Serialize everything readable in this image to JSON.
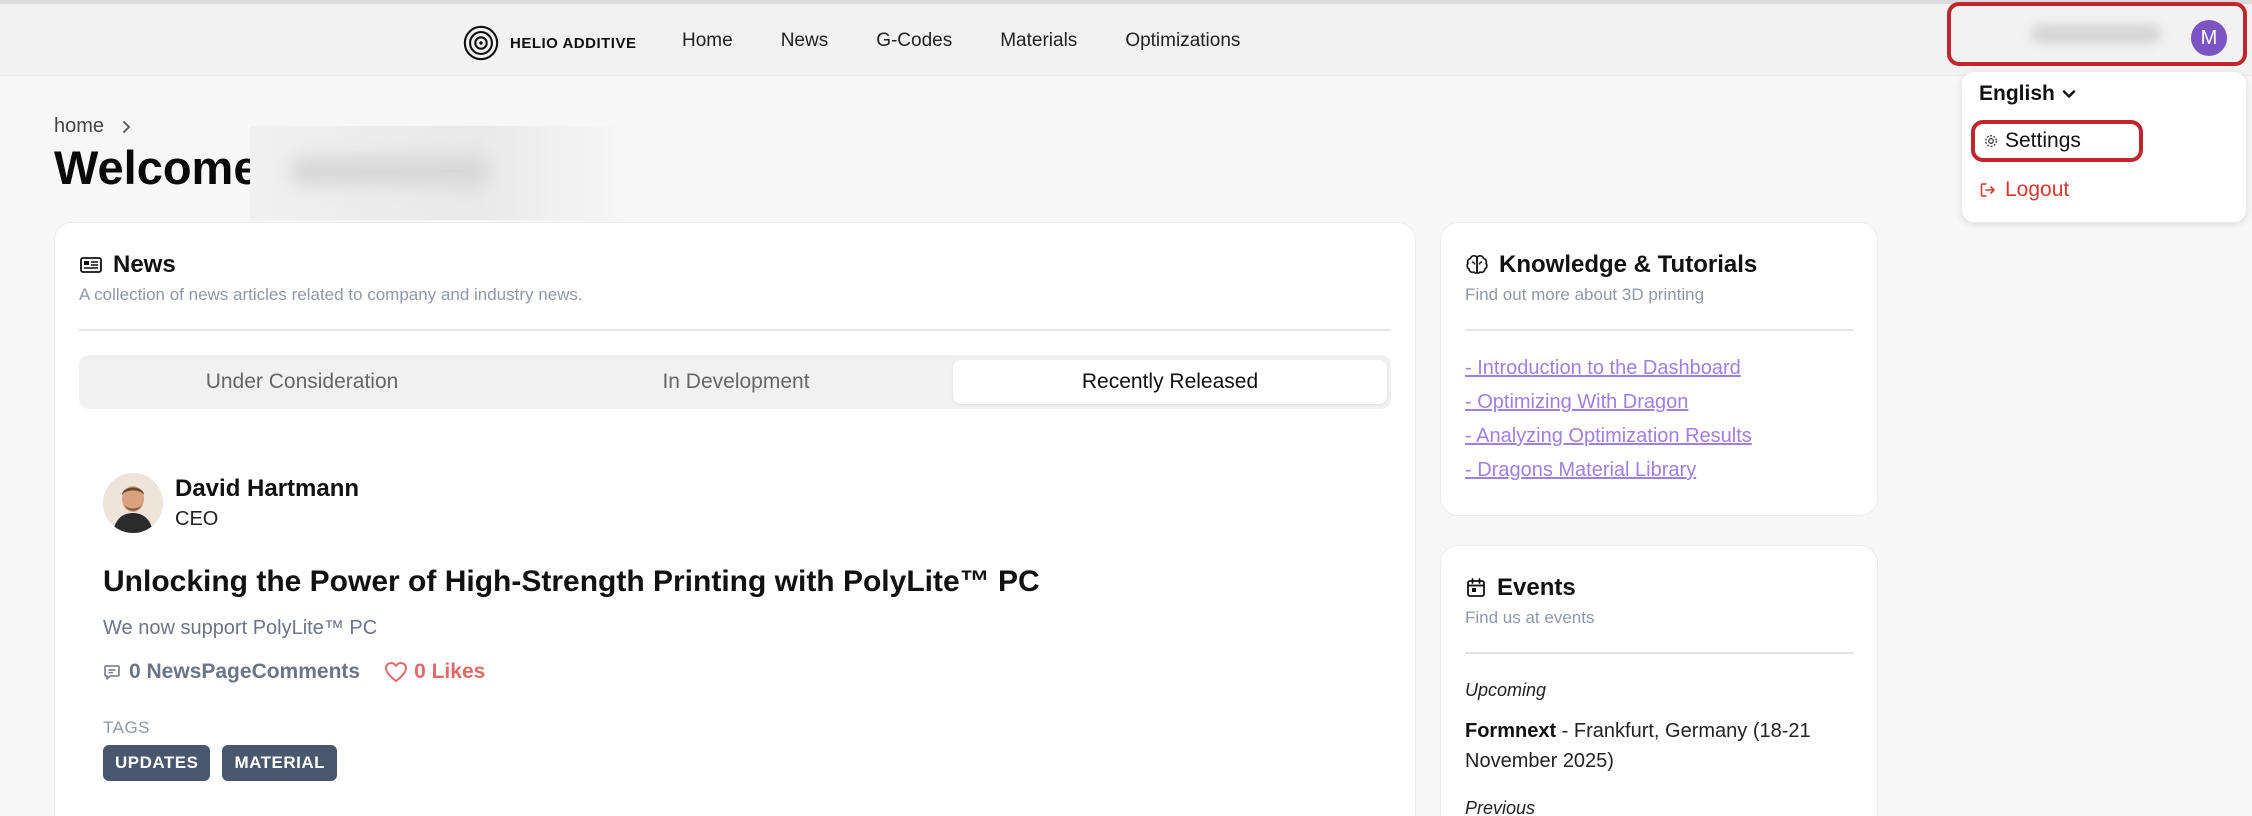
{
  "brand": {
    "name": "HELIO ADDITIVE"
  },
  "nav": [
    {
      "label": "Home"
    },
    {
      "label": "News"
    },
    {
      "label": "G-Codes"
    },
    {
      "label": "Materials"
    },
    {
      "label": "Optimizations"
    }
  ],
  "user": {
    "avatar_initial": "M"
  },
  "dropdown": {
    "language": "English",
    "settings": "Settings",
    "logout": "Logout"
  },
  "breadcrumb": {
    "home": "home"
  },
  "page": {
    "title": "Welcome"
  },
  "news": {
    "title": "News",
    "subtitle": "A collection of news articles related to company and industry news.",
    "tabs": [
      {
        "label": "Under Consideration"
      },
      {
        "label": "In Development"
      },
      {
        "label": "Recently Released"
      }
    ],
    "active_tab": "Recently Released",
    "article": {
      "author_name": "David Hartmann",
      "author_role": "CEO",
      "title": "Unlocking the Power of High-Strength Printing with PolyLite™ PC",
      "subtitle": "We now support PolyLite™ PC",
      "comments": "0 NewsPageComments",
      "likes": "0 Likes",
      "tags_label": "TAGS",
      "tags": [
        "UPDATES",
        "MATERIAL"
      ]
    }
  },
  "knowledge": {
    "title": "Knowledge & Tutorials",
    "subtitle": "Find out more about 3D printing",
    "links": [
      "- Introduction to the Dashboard",
      "- Optimizing With Dragon",
      "- Analyzing Optimization Results",
      "- Dragons Material Library"
    ]
  },
  "events": {
    "title": "Events",
    "subtitle": "Find us at events",
    "upcoming_label": "Upcoming",
    "upcoming_name": "Formnext",
    "upcoming_detail": " - Frankfurt, Germany (18-21 November 2025)",
    "previous_label": "Previous"
  },
  "colors": {
    "accent_purple": "#7b55c4",
    "link_purple": "#a07ee6",
    "danger": "#d33a32",
    "highlight_red": "#c0272d",
    "tag_bg": "#48566e"
  }
}
